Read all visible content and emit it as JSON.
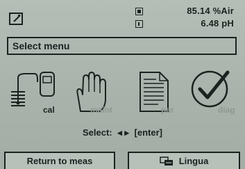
{
  "readings": [
    {
      "value": "85.14 %Air"
    },
    {
      "value": "6.48 pH"
    }
  ],
  "menu": {
    "title": "Select menu"
  },
  "icons": [
    {
      "label": "cal",
      "icon": "calibration-probe-icon",
      "active": true
    },
    {
      "label": "maint",
      "icon": "hand-icon",
      "active": false
    },
    {
      "label": "par",
      "icon": "document-icon",
      "active": false
    },
    {
      "label": "diag",
      "icon": "checkmark-circle-icon",
      "active": false
    }
  ],
  "select": {
    "prefix": "Select:",
    "arrows": "◂ ▸",
    "enter": "[enter]"
  },
  "softkeys": {
    "left": "Return to meas",
    "right": "Lingua"
  },
  "colors": {
    "background": "#aeb8b1",
    "ink": "#1b2220",
    "dim": "#8e9993"
  }
}
